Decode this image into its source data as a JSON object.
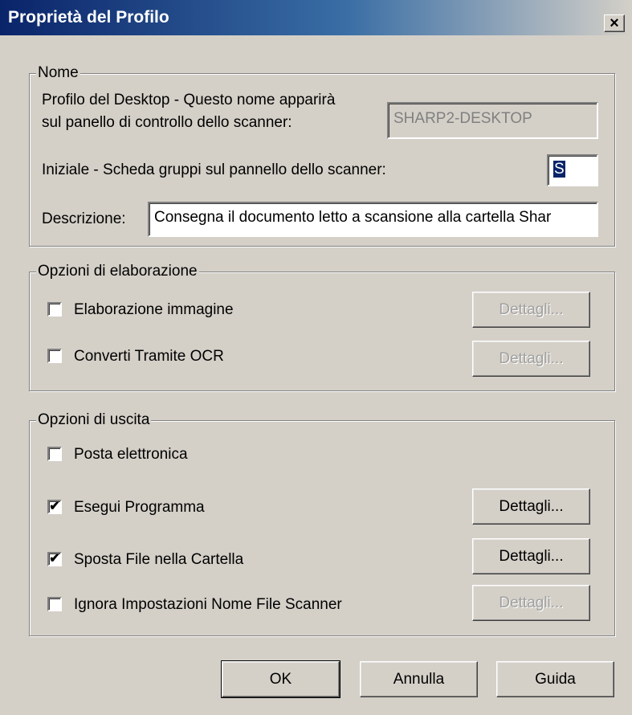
{
  "window": {
    "title": "Proprietà del Profilo",
    "close_label": "×"
  },
  "nome": {
    "legend": "Nome",
    "profile_label_line1": "Profilo del Desktop - Questo nome apparirà",
    "profile_label_line2": "sul panello di controllo dello scanner:",
    "profile_value": "SHARP2-DESKTOP",
    "initial_label": "Iniziale - Scheda gruppi sul pannello dello scanner:",
    "initial_value": "S",
    "description_label": "Descrizione:",
    "description_value": "Consegna il documento letto a scansione alla cartella Shar"
  },
  "elaborazione": {
    "legend": "Opzioni di elaborazione",
    "options": [
      {
        "label": "Elaborazione immagine",
        "checked": false,
        "details": "Dettagli...",
        "details_enabled": false
      },
      {
        "label": "Converti Tramite OCR",
        "checked": false,
        "details": "Dettagli...",
        "details_enabled": false
      }
    ]
  },
  "uscita": {
    "legend": "Opzioni di uscita",
    "options": [
      {
        "label": "Posta elettronica",
        "checked": false
      },
      {
        "label": "Esegui Programma",
        "checked": true,
        "details": "Dettagli...",
        "details_enabled": true
      },
      {
        "label": "Sposta File nella Cartella",
        "checked": true,
        "details": "Dettagli...",
        "details_enabled": true
      },
      {
        "label": "Ignora Impostazioni Nome File Scanner",
        "checked": false,
        "details": "Dettagli...",
        "details_enabled": false
      }
    ]
  },
  "buttons": {
    "ok": "OK",
    "cancel": "Annulla",
    "help": "Guida"
  },
  "check_mark": "✔"
}
